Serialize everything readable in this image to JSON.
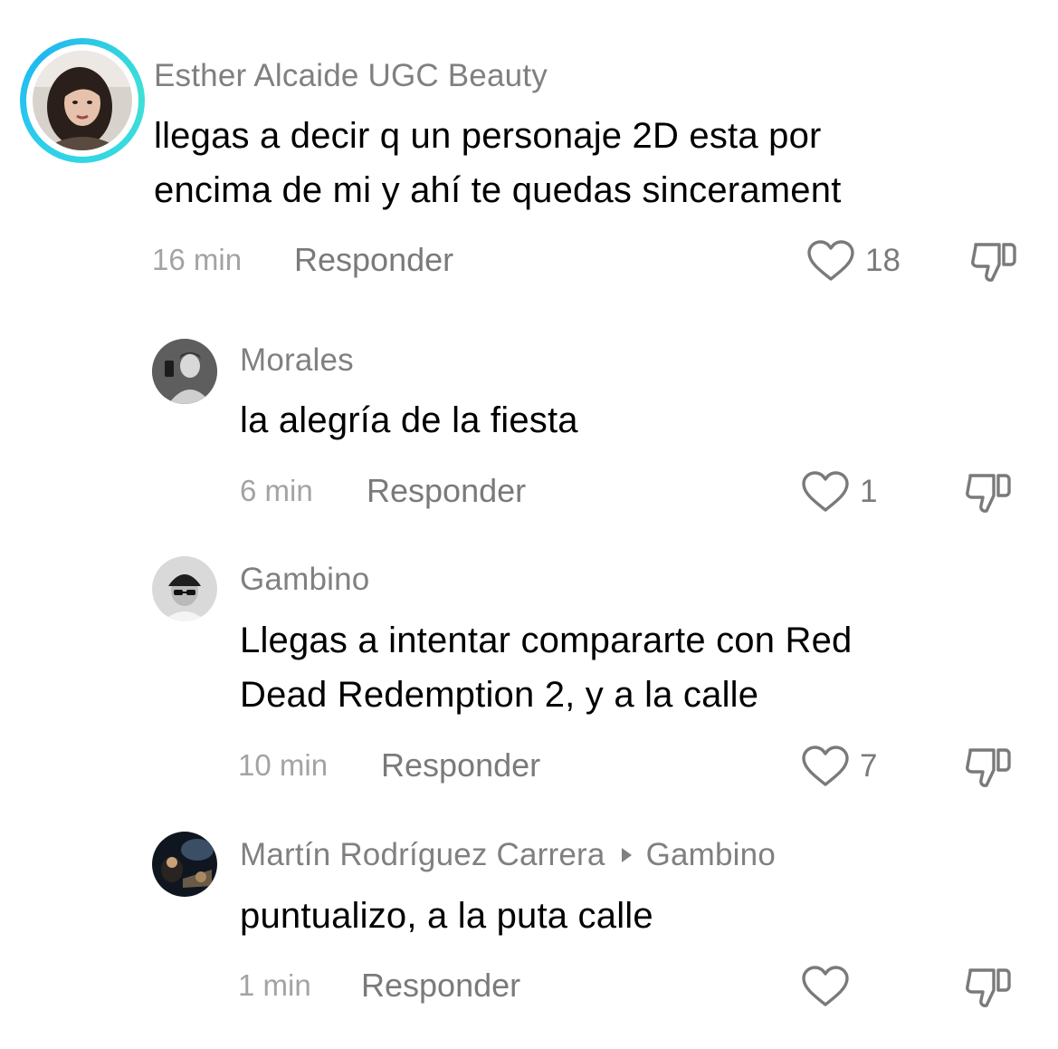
{
  "comments": [
    {
      "username": "Esther Alcaide UGC Beauty",
      "text_lines": [
        "llegas a decir q un personaje 2D esta por",
        "encima de mi y ahí te quedas sincerament"
      ],
      "time": "16 min",
      "reply_label": "Responder",
      "likes": "18",
      "avatar_icon": "profile-photo-woman",
      "has_story_ring": true,
      "story_ring_color": "#2fd4e8"
    },
    {
      "username": "Morales",
      "text_lines": [
        "la alegría de la fiesta"
      ],
      "time": "6 min",
      "reply_label": "Responder",
      "likes": "1",
      "avatar_icon": "profile-photo-mirror-selfie"
    },
    {
      "username": "Gambino",
      "text_lines": [
        "Llegas a intentar compararte con Red",
        "Dead Redemption 2, y a la calle"
      ],
      "time": "10 min",
      "reply_label": "Responder",
      "likes": "7",
      "avatar_icon": "profile-photo-cartoon-cap"
    },
    {
      "username": "Martín Rodríguez Carrera",
      "reply_to": "Gambino",
      "text_lines": [
        "puntualizo, a la puta calle"
      ],
      "time": "1 min",
      "reply_label": "Responder",
      "likes": "",
      "avatar_icon": "profile-photo-dark-scene"
    }
  ],
  "icons": {
    "like": "heart-outline-icon",
    "dislike": "thumbs-down-outline-icon",
    "reply_to": "triangle-right-icon"
  },
  "colors": {
    "username": "#808080",
    "text": "#000000",
    "meta": "#a3a3a3",
    "action": "#7a7a7a"
  }
}
